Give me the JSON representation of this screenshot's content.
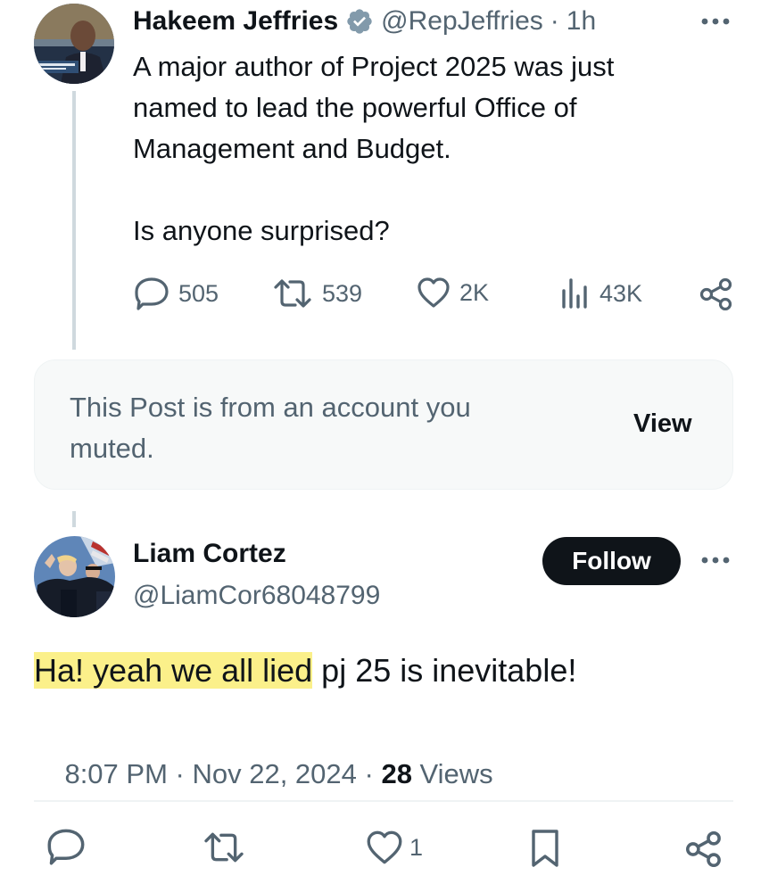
{
  "tweet1": {
    "author_name": "Hakeem Jeffries",
    "handle": "@RepJeffries",
    "dot": "·",
    "time": "1h",
    "verified": true,
    "text_lines": [
      "A major author of Project 2025 was just",
      "named to lead the powerful Office of",
      "Management and Budget.",
      "",
      "Is anyone surprised?"
    ],
    "stats": {
      "replies": "505",
      "reposts": "539",
      "likes": "2K",
      "views": "43K"
    }
  },
  "muted_notice": {
    "text_line1": "This Post is from an account you",
    "text_line2": "muted.",
    "view_label": "View"
  },
  "tweet2": {
    "author_name": "Liam Cortez",
    "handle": "@LiamCor68048799",
    "follow_label": "Follow",
    "text_highlighted": "Ha! yeah we all lied",
    "text_rest": " pj 25 is inevitable!",
    "time": "8:07 PM",
    "sep1": " · ",
    "date": "Nov 22, 2024",
    "sep2": " · ",
    "views_count": "28",
    "views_label": " Views",
    "actions": {
      "like_count": "1"
    }
  },
  "colors": {
    "text": "#0f1419",
    "secondary": "#536471",
    "verified_badge": "#829aab",
    "highlight": "#fbf08a",
    "follow_bg": "#0f1419",
    "muted_box_bg": "#f7f9f9",
    "border": "#eff3f4"
  },
  "icons": {
    "reply": "reply-icon",
    "repost": "repost-icon",
    "like": "heart-icon",
    "views": "views-icon",
    "share": "share-icon",
    "bookmark": "bookmark-icon",
    "more": "more-icon",
    "verified": "verified-badge-icon"
  }
}
